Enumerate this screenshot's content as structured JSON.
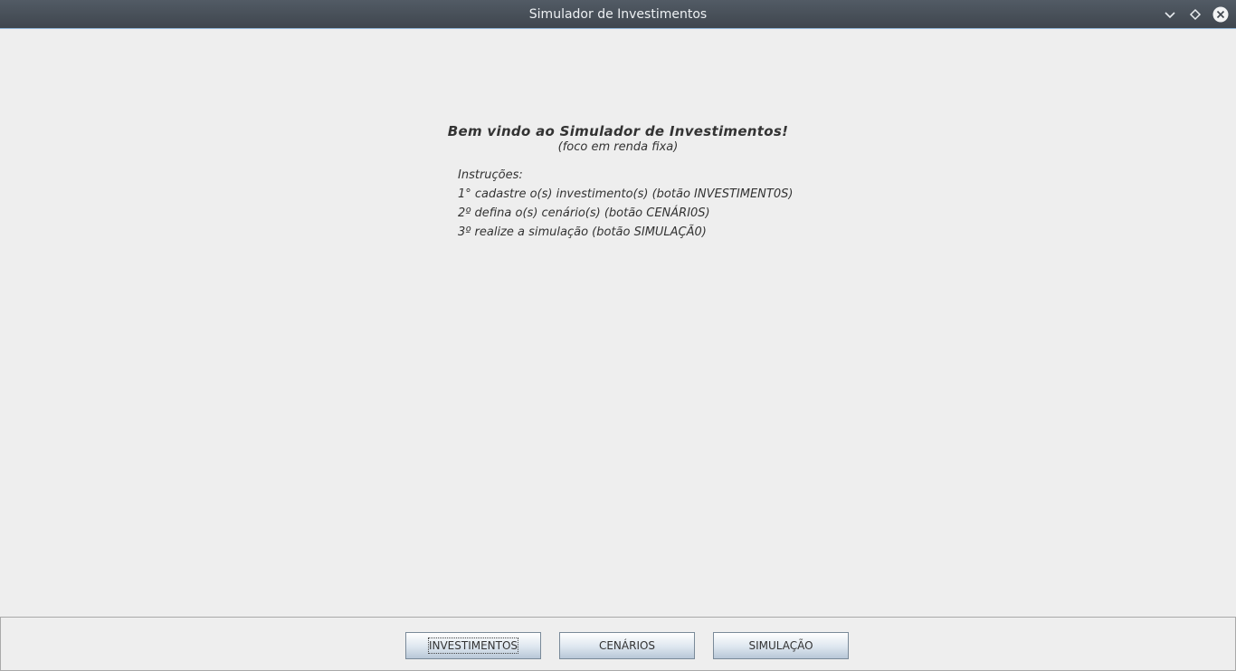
{
  "window": {
    "title": "Simulador de Investimentos",
    "controls": [
      "minimize-icon",
      "maximize-icon",
      "close-icon"
    ]
  },
  "main": {
    "welcome": "Bem vindo ao Simulador de Investimentos!",
    "subtitle": "(foco em renda fixa)",
    "instructions_heading": "Instruções:",
    "steps": [
      "1° cadastre o(s) investimento(s) (botão INVESTIMENT0S)",
      "2º defina o(s) cenário(s) (botão CENÁRI0S)",
      "3º realize a simulação (botão SIMULAÇÃ0)"
    ]
  },
  "footer": {
    "buttons": [
      {
        "label": "INVESTIMENTOS",
        "focused": true
      },
      {
        "label": "CENÁRIOS",
        "focused": false
      },
      {
        "label": "SIMULAÇÃO",
        "focused": false
      }
    ]
  },
  "colors": {
    "titlebar": "#4a525b",
    "titlebar_border": "#8fb4d6",
    "background": "#eeeeee",
    "text": "#333333"
  }
}
